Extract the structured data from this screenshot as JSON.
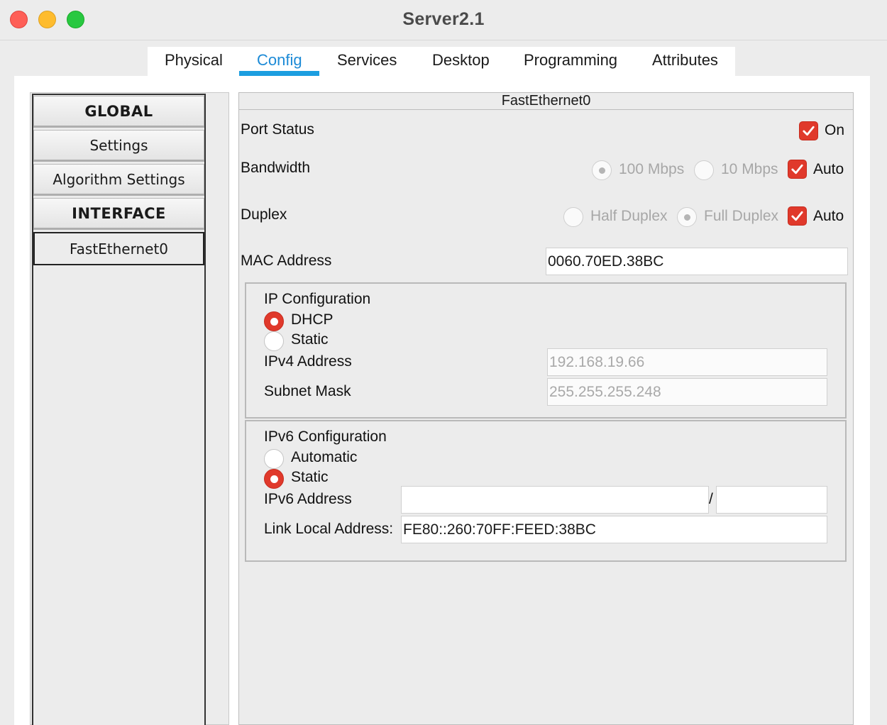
{
  "window": {
    "title": "Server2.1"
  },
  "tabs": [
    {
      "label": "Physical"
    },
    {
      "label": "Config"
    },
    {
      "label": "Services"
    },
    {
      "label": "Desktop"
    },
    {
      "label": "Programming"
    },
    {
      "label": "Attributes"
    }
  ],
  "active_tab": "Config",
  "sidebar": {
    "items": [
      {
        "label": "GLOBAL",
        "kind": "header"
      },
      {
        "label": "Settings",
        "kind": "item"
      },
      {
        "label": "Algorithm Settings",
        "kind": "item"
      },
      {
        "label": "INTERFACE",
        "kind": "header"
      },
      {
        "label": "FastEthernet0",
        "kind": "item",
        "selected": true
      }
    ]
  },
  "panel": {
    "title": "FastEthernet0",
    "port_status": {
      "label": "Port Status",
      "on_label": "On",
      "on_checked": true
    },
    "bandwidth": {
      "label": "Bandwidth",
      "opt1": "100 Mbps",
      "opt2": "10 Mbps",
      "auto_label": "Auto",
      "auto_checked": true
    },
    "duplex": {
      "label": "Duplex",
      "opt1": "Half Duplex",
      "opt2": "Full Duplex",
      "auto_label": "Auto",
      "auto_checked": true
    },
    "mac": {
      "label": "MAC Address",
      "value": "0060.70ED.38BC"
    },
    "ipv4": {
      "title": "IP Configuration",
      "dhcp_label": "DHCP",
      "static_label": "Static",
      "selected": "DHCP",
      "address_label": "IPv4 Address",
      "address_value": "192.168.19.66",
      "mask_label": "Subnet Mask",
      "mask_value": "255.255.255.248"
    },
    "ipv6": {
      "title": "IPv6 Configuration",
      "auto_label": "Automatic",
      "static_label": "Static",
      "selected": "Static",
      "address_label": "IPv6 Address",
      "address_value": "",
      "prefix_separator": "/",
      "prefix_value": "",
      "link_local_label": "Link Local Address:",
      "link_local_value": "FE80::260:70FF:FEED:38BC"
    }
  },
  "colors": {
    "accent_tab": "#1c8ad6",
    "checkbox": "#e0392b",
    "close": "#fe5f57",
    "minimize": "#febc2e",
    "maximize": "#28c840"
  }
}
